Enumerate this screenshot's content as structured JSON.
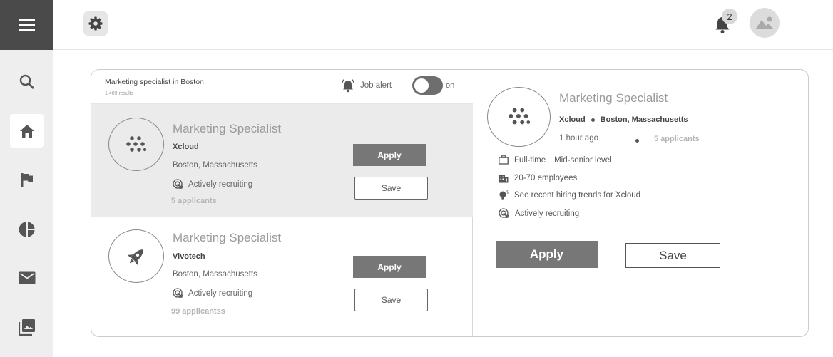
{
  "header": {
    "notification_count": "2"
  },
  "search": {
    "query": "Marketing specialist in Boston",
    "results": "1,409 results",
    "job_alert_label": "Job alert",
    "toggle_state": "on"
  },
  "jobs": [
    {
      "title": "Marketing Specialist",
      "company": "Xcloud",
      "location": "Boston, Massachusetts",
      "recruiting": "Actively recruiting",
      "applicants": "5 applicants",
      "apply_label": "Apply",
      "save_label": "Save",
      "logo_icon": "cloud-dots-icon"
    },
    {
      "title": "Marketing Specialist",
      "company": "Vivotech",
      "location": "Boston, Massachusetts",
      "recruiting": "Actively recruiting",
      "applicants": "99 applicantss",
      "apply_label": "Apply",
      "save_label": "Save",
      "logo_icon": "rocket-icon"
    }
  ],
  "detail": {
    "title": "Marketing Specialist",
    "company": "Xcloud",
    "location": "Boston, Massachusetts",
    "posted": "1 hour ago",
    "applicants": "5 applicants",
    "employment_type": "Full-time",
    "level": "Mid-senior level",
    "size": "20-70 employees",
    "trends": "See recent hiring trends for Xcloud",
    "recruiting": "Actively recruiting",
    "apply_label": "Apply",
    "save_label": "Save"
  },
  "colors": {
    "sidebar_bg": "#eeeeee",
    "menu_bg": "#4a4a4a",
    "selected_row_bg": "#ebebeb",
    "apply_bg": "#777777"
  }
}
